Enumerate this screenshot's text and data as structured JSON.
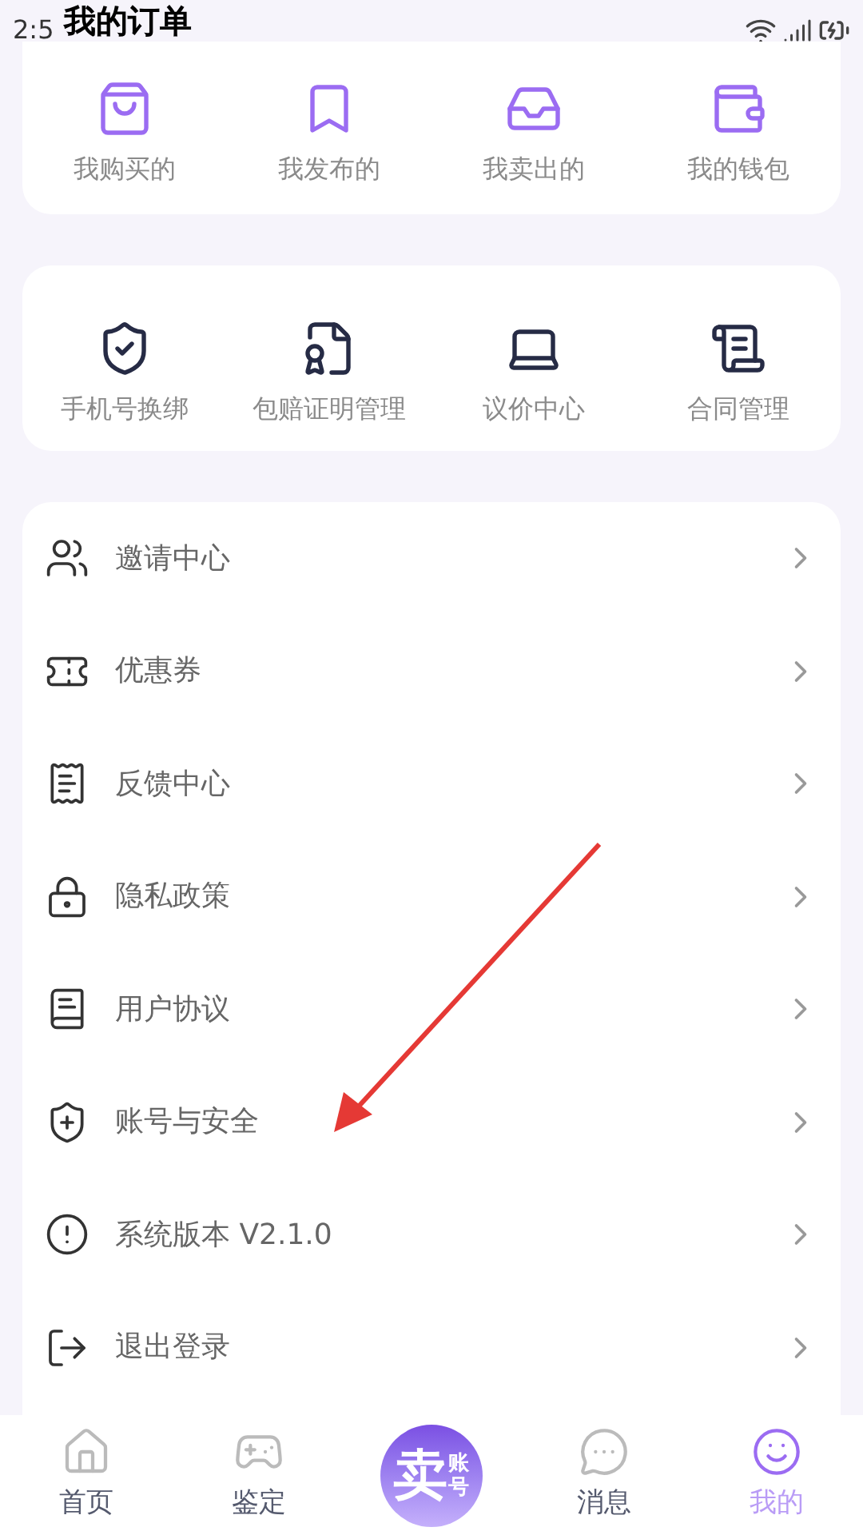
{
  "status_bar": {
    "time": "2:5"
  },
  "title": "我的订单",
  "orders": [
    {
      "label": "我购买的"
    },
    {
      "label": "我发布的"
    },
    {
      "label": "我卖出的"
    },
    {
      "label": "我的钱包"
    }
  ],
  "services": [
    {
      "label": "手机号换绑"
    },
    {
      "label": "包赔证明管理"
    },
    {
      "label": "议价中心"
    },
    {
      "label": "合同管理"
    }
  ],
  "menu": [
    {
      "label": "邀请中心"
    },
    {
      "label": "优惠券"
    },
    {
      "label": "反馈中心"
    },
    {
      "label": "隐私政策"
    },
    {
      "label": "用户协议"
    },
    {
      "label": "账号与安全"
    },
    {
      "label": "系统版本 V2.1.0"
    },
    {
      "label": "退出登录"
    }
  ],
  "nav": [
    {
      "kind": "tab",
      "label": "首页",
      "selected": false
    },
    {
      "kind": "tab",
      "label": "鉴定",
      "selected": false
    },
    {
      "kind": "center",
      "label": "卖",
      "sublabel": "账号",
      "selected": false
    },
    {
      "kind": "tab",
      "label": "消息",
      "selected": false
    },
    {
      "kind": "tab",
      "label": "我的",
      "selected": true
    }
  ]
}
